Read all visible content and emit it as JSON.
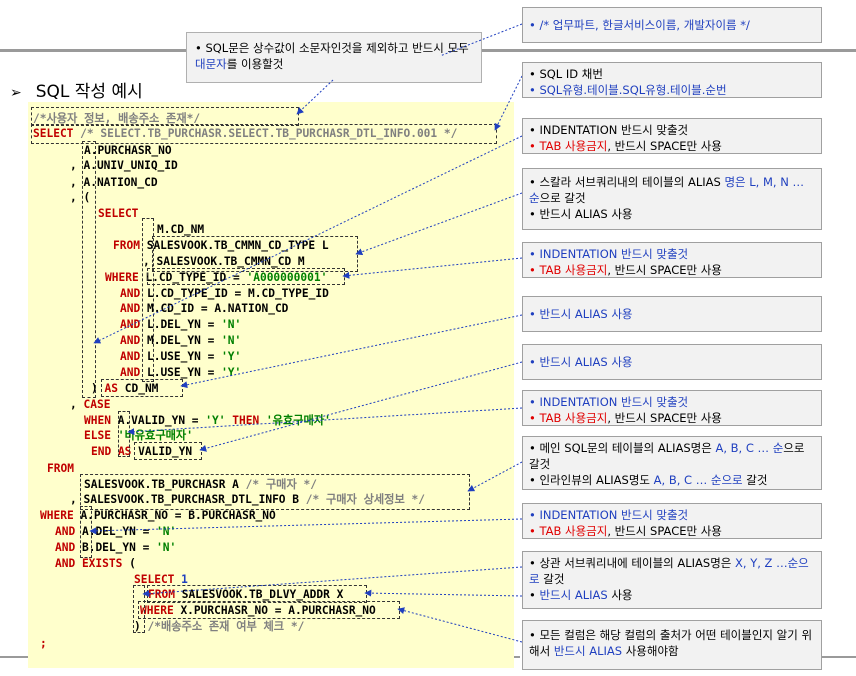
{
  "heading": "SQL 작성 예시",
  "note_top": {
    "pre": "• SQL문은 상수값이 소문자인것을 제외하고 반드시 모두 ",
    "hl": "대문자",
    "post": "를 이용할것"
  },
  "callouts": {
    "c1": "/* 업무파트, 한글서비스이름, 개발자이름 */",
    "c2a": "SQL ID 채번",
    "c2b": "SQL유형.테이블.SQL유형.테이블.순번",
    "c3a": "INDENTATION 반드시 맞출것",
    "c3b_red": "TAB 사용금지",
    "c3b_rest": ", 반드시 SPACE만 사용",
    "c4a_pre": "스칼라 서브쿼리내의 테이블의 ALIAS ",
    "c4a_hl": "명은 L, M, N … 순",
    "c4a_post": "으로 갈것",
    "c4b": "반드시 ALIAS  사용",
    "c5a": "INDENTATION 반드시 맞출것",
    "c5b_red": "TAB 사용금지",
    "c5b_rest": ", 반드시 SPACE만 사용",
    "c6": "반드시 ALIAS  사용",
    "c7": "반드시 ALIAS  사용",
    "c8a": "INDENTATION 반드시 맞출것",
    "c8b_red": "TAB 사용금지",
    "c8b_rest": ", 반드시 SPACE만 사용",
    "c9a_pre": "메인 SQL문의 테이블의 ALIAS명은 ",
    "c9a_hl": "A, B, C … 순",
    "c9a_post": "으로 갈것",
    "c9b_pre": "인라인뷰의 ALIAS명도 ",
    "c9b_hl": "A, B, C … 순으로",
    "c9b_post": " 갈것",
    "c10a": "INDENTATION 반드시 맞출것",
    "c10b_red": "TAB 사용금지",
    "c10b_rest": ", 반드시 SPACE만 사용",
    "c11a_pre": "상관 서브쿼리내에 테이블의 ALIAS명은 ",
    "c11a_hl": "X, Y, Z …순으로",
    "c11a_post": " 갈것",
    "c11b_hl": "반드시 ALIAS",
    "c11b_post": " 사용",
    "c12_pre": "모든 컬럼은 해당 컬럼의 출처가 어떤 테이블인지 알기 위해서 ",
    "c12_hl": "반드시 ALIAS",
    "c12_post": " 사용해야함"
  },
  "code": {
    "l1": "/*사용자 정보, 배송주소 존재*/",
    "l2_kw": "SELECT",
    "l2_cm": "/* SELECT.TB_PURCHASR.SELECT.TB_PURCHASR_DTL_INFO.001 */",
    "l3": "A.PURCHASR_NO",
    "l4": ", A.UNIV_UNIQ_ID",
    "l5": ", A.NATION_CD",
    "l6": ", (",
    "l7": "SELECT",
    "l8": "M.CD_NM",
    "l9_kw": "FROM",
    "l9": "SALESVOOK.TB_CMMN_CD_TYPE L",
    "l10": ", SALESVOOK.TB_CMMN_CD M",
    "l11_kw": "WHERE",
    "l11": "L.CD_TYPE_ID = ",
    "l11_str": "'A000000001'",
    "l12_kw": "AND",
    "l12": "L.CD_TYPE_ID = M.CD_TYPE_ID",
    "l13_kw": "AND",
    "l13": "M.CD_ID = A.NATION_CD",
    "l14_kw": "AND",
    "l14": "L.DEL_YN = ",
    "l14_str": "'N'",
    "l15_kw": "AND",
    "l15": "M.DEL_YN = ",
    "l15_str": "'N'",
    "l16_kw": "AND",
    "l16": "L.USE_YN = ",
    "l16_str": "'Y'",
    "l17_kw": "AND",
    "l17": "L.USE_YN = ",
    "l17_str": "'Y'",
    "l18a": ")",
    "l18_kw": "AS",
    "l18": "CD_NM",
    "l19_pre": ",",
    "l19_kw": "CASE",
    "l20_kw": "WHEN",
    "l20": "A.VALID_YN = ",
    "l20_str": "'Y'",
    "l20_kw2": "THEN",
    "l20_str2": "'유효구매자'",
    "l21_kw": "ELSE",
    "l21_str": "'비유효구매자'",
    "l22_kw": "END AS",
    "l22": "VALID_YN",
    "l23_kw": "FROM",
    "l24": "SALESVOOK.TB_PURCHASR A ",
    "l24_cm": "/* 구매자 */",
    "l25": ", SALESVOOK.TB_PURCHASR_DTL_INFO B ",
    "l25_cm": "/* 구매자 상세정보 */",
    "l26_kw": "WHERE",
    "l26": "A.PURCHASR_NO = B.PURCHASR_NO",
    "l27_kw": "AND",
    "l27": "A.DEL_YN = ",
    "l27_str": "'N'",
    "l28_kw": "AND",
    "l28": "B.DEL_YN = ",
    "l28_str": "'N'",
    "l29_kw": "AND EXISTS",
    "l29": "(",
    "l30_kw": "SELECT",
    "l30": "1",
    "l31_kw": "FROM",
    "l31": "SALESVOOK.TB_DLVY_ADDR X",
    "l32_kw": "WHERE",
    "l32": "X.PURCHASR_NO = A.PURCHASR_NO",
    "l33": ")",
    "l33_cm": "/*배송주소 존재 여부 체크 */",
    "l34": ";"
  }
}
